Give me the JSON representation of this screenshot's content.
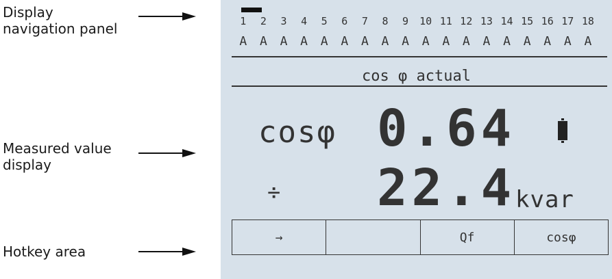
{
  "callouts": {
    "nav_label": "Display\nnavigation panel",
    "measured_label": "Measured value\ndisplay",
    "hotkey_label": "Hotkey area"
  },
  "nav": {
    "numbers": [
      "1",
      "2",
      "3",
      "4",
      "5",
      "6",
      "7",
      "8",
      "9",
      "10",
      "11",
      "12",
      "13",
      "14",
      "15",
      "16",
      "17",
      "18"
    ],
    "letters": [
      "A",
      "A",
      "A",
      "A",
      "A",
      "A",
      "A",
      "A",
      "A",
      "A",
      "A",
      "A",
      "A",
      "A",
      "A",
      "A",
      "A",
      "A"
    ],
    "active_index": 2
  },
  "screen": {
    "title": "cos φ actual",
    "row1": {
      "label": "cosφ",
      "value": "0.64",
      "indicator": "battery-icon"
    },
    "row2": {
      "label": "÷",
      "value": "22.4",
      "unit": "kvar"
    }
  },
  "hotkeys": [
    {
      "label": "→",
      "icon": "arrow-right-icon"
    },
    {
      "label": ""
    },
    {
      "label": "Qf"
    },
    {
      "label": "cosφ"
    }
  ],
  "colors": {
    "lcd_background": "#d7e1ea",
    "lcd_ink": "#333333"
  }
}
